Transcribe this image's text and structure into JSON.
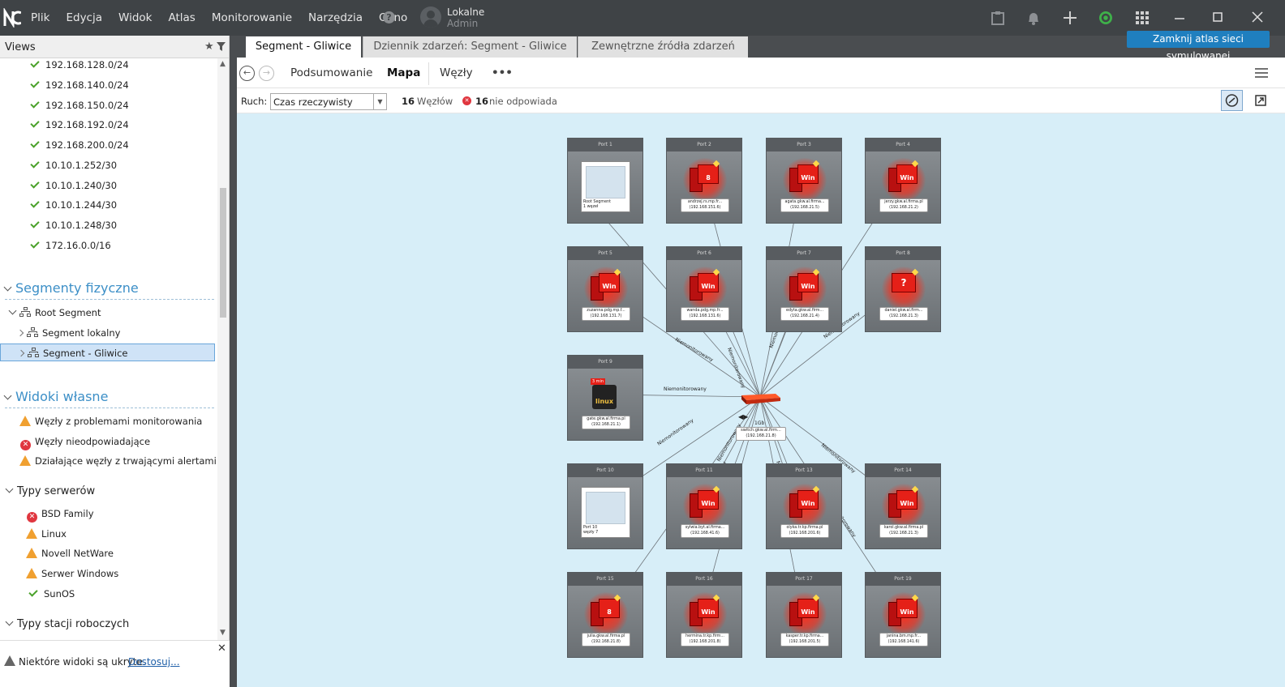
{
  "menu": {
    "items": [
      "Plik",
      "Edycja",
      "Widok",
      "Atlas",
      "Monitorowanie",
      "Narzędzia",
      "Okno"
    ],
    "help": "?",
    "user_line1": "Lokalne",
    "user_line2": "Admin"
  },
  "tooltip": "Zamknij atlas sieci symulowanej",
  "views": {
    "title": "Views",
    "subnets": [
      "192.168.128.0/24",
      "192.168.140.0/24",
      "192.168.150.0/24",
      "192.168.192.0/24",
      "192.168.200.0/24",
      "10.10.1.252/30",
      "10.10.1.240/30",
      "10.10.1.244/30",
      "10.10.1.248/30",
      "172.16.0.0/16"
    ],
    "physical_title": "Segmenty fizyczne",
    "physical": [
      "Root Segment",
      "Segment lokalny",
      "Segment - Gliwice"
    ],
    "custom_title": "Widoki własne",
    "custom": [
      {
        "icon": "warning-icon",
        "label": "Węzły z problemami monitorowania"
      },
      {
        "icon": "error-icon",
        "label": "Węzły nieodpowiadające"
      },
      {
        "icon": "warning-icon",
        "label": "Działające węzły z trwającymi alertami"
      }
    ],
    "server_types_title": "Typy serwerów",
    "server_types": [
      {
        "icon": "error-icon",
        "label": "BSD Family"
      },
      {
        "icon": "warning-icon",
        "label": "Linux"
      },
      {
        "icon": "warning-icon",
        "label": "Novell NetWare"
      },
      {
        "icon": "warning-icon",
        "label": "Serwer Windows"
      },
      {
        "icon": "check-icon",
        "label": "SunOS"
      }
    ],
    "workstation_types_title": "Typy stacji roboczych",
    "footer_text": "Niektóre widoki są ukryte.",
    "footer_link": "Dostosuj..."
  },
  "tabs": [
    "Segment - Gliwice",
    "Dziennik zdarzeń: Segment - Gliwice",
    "Zewnętrzne źródła zdarzeń"
  ],
  "nav": {
    "summary": "Podsumowanie",
    "map": "Mapa",
    "nodes": "Węzły",
    "more": "•••"
  },
  "filter": {
    "traffic_label": "Ruch:",
    "traffic_value": "Czas rzeczywisty",
    "nodes_count": "16",
    "nodes_label": "Węzłów",
    "noresp_count": "16",
    "noresp_label": "nie odpowiada"
  },
  "map": {
    "edge_label": "Niemonitorowany",
    "switch_label_1": "switch.gkw.al.firm...",
    "switch_label_2": "(192.168.21.8)",
    "switch_badge": "1Gb",
    "tiles": [
      {
        "port": "Port 1",
        "type": "segment",
        "name": "Root Segment",
        "ip": "1 węzeł"
      },
      {
        "port": "Port 2",
        "type": "win",
        "os": "8",
        "name": "andrzej.rs.mp.fr...",
        "ip": "(192.168.151.6)"
      },
      {
        "port": "Port 3",
        "type": "win",
        "os": "Win 7",
        "name": "agata.gkw.al.firma...",
        "ip": "(192.168.21.5)"
      },
      {
        "port": "Port 4",
        "type": "win",
        "os": "Win 7",
        "name": "jerzy.gkw.al.firma.pl",
        "ip": "(192.168.21.2)"
      },
      {
        "port": "Port 5",
        "type": "win",
        "os": "Win 7",
        "name": "zuzanna.pdg.mp.f...",
        "ip": "(192.168.131.7)"
      },
      {
        "port": "Port 6",
        "type": "win",
        "os": "Win 7",
        "name": "wanda.pdg.mp.fr...",
        "ip": "(192.168.131.6)"
      },
      {
        "port": "Port 7",
        "type": "win",
        "os": "Win 7",
        "name": "edyta.gkw.al.firm...",
        "ip": "(192.168.21.4)"
      },
      {
        "port": "Port 8",
        "type": "unknown",
        "os": "?",
        "name": "daniel.gkw.al.firm...",
        "ip": "(192.168.21.3)"
      },
      {
        "port": "Port 9",
        "type": "linux",
        "os": "linux",
        "badge": "3 min",
        "name": "gate.gkw.al.firma.pl",
        "ip": "(192.168.21.1)"
      },
      {
        "port": "Port 10",
        "type": "segment",
        "name": "Port 10",
        "ip": "węzły 7"
      },
      {
        "port": "Port 11",
        "type": "win",
        "os": "Win 7",
        "name": "sylwia.byt.al.firma...",
        "ip": "(192.168.41.6)"
      },
      {
        "port": "Port 13",
        "type": "win",
        "os": "Win 7",
        "name": "olyka.tr.kp.firma.pl",
        "ip": "(192.168.201.6)"
      },
      {
        "port": "Port 14",
        "type": "win",
        "os": "Win 7",
        "name": "karol.gkw.al.firma.pl",
        "ip": "(192.168.21.3)"
      },
      {
        "port": "Port 15",
        "type": "win",
        "os": "8",
        "name": "julia.gkw.al.firma.pl",
        "ip": "(192.168.21.8)"
      },
      {
        "port": "Port 16",
        "type": "win",
        "os": "Win 7",
        "name": "hermina.tr.kp.firm...",
        "ip": "(192.168.201.8)"
      },
      {
        "port": "Port 17",
        "type": "win",
        "os": "Win 7",
        "name": "kasper.tr.kp.firma...",
        "ip": "(192.168.201.5)"
      },
      {
        "port": "Port 19",
        "type": "win",
        "os": "Win 7",
        "name": "janina.bm.mp.fr...",
        "ip": "(192.168.141.6)"
      }
    ]
  },
  "colors": {
    "topbar": "#3f4346",
    "accent": "#3c8fc7",
    "map_bg": "#d7eef8",
    "tooltip": "#1f7fbf"
  }
}
